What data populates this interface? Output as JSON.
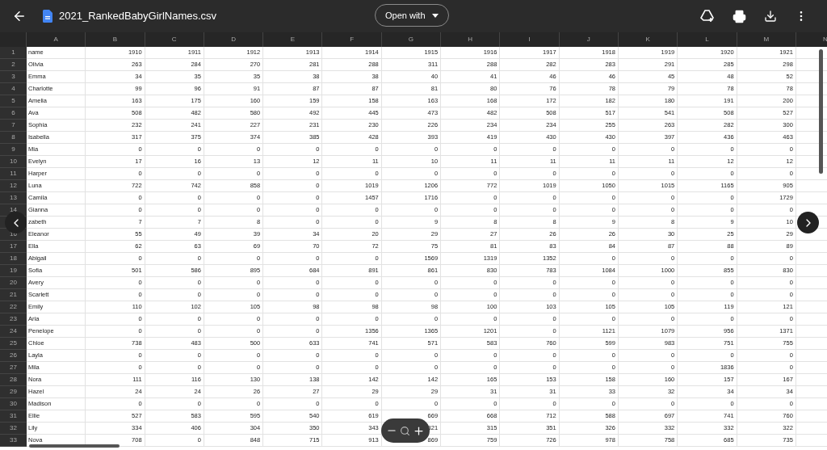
{
  "file": {
    "title": "2021_RankedBabyGirlNames.csv"
  },
  "toolbar": {
    "open_with": "Open with"
  },
  "columns": [
    "A",
    "B",
    "C",
    "D",
    "E",
    "F",
    "G",
    "H",
    "I",
    "J",
    "K",
    "L",
    "M",
    "N"
  ],
  "rows": [
    {
      "number": "1",
      "name": "name",
      "values": [
        "1910",
        "1911",
        "1912",
        "1913",
        "1914",
        "1915",
        "1916",
        "1917",
        "1918",
        "1919",
        "1920",
        "1921"
      ]
    },
    {
      "number": "2",
      "name": "Olivia",
      "values": [
        "263",
        "284",
        "270",
        "281",
        "288",
        "311",
        "288",
        "282",
        "283",
        "291",
        "285",
        "298"
      ]
    },
    {
      "number": "3",
      "name": "Emma",
      "values": [
        "34",
        "35",
        "35",
        "38",
        "38",
        "40",
        "41",
        "46",
        "46",
        "45",
        "48",
        "52"
      ]
    },
    {
      "number": "4",
      "name": "Charlotte",
      "values": [
        "99",
        "96",
        "91",
        "87",
        "87",
        "81",
        "80",
        "76",
        "78",
        "79",
        "78",
        "78"
      ]
    },
    {
      "number": "5",
      "name": "Amelia",
      "values": [
        "163",
        "175",
        "160",
        "159",
        "158",
        "163",
        "168",
        "172",
        "182",
        "180",
        "191",
        "200"
      ]
    },
    {
      "number": "6",
      "name": "Ava",
      "values": [
        "508",
        "482",
        "580",
        "492",
        "445",
        "473",
        "482",
        "508",
        "517",
        "541",
        "508",
        "527"
      ]
    },
    {
      "number": "7",
      "name": "Sophia",
      "values": [
        "232",
        "241",
        "227",
        "231",
        "230",
        "226",
        "234",
        "234",
        "255",
        "263",
        "282",
        "300"
      ]
    },
    {
      "number": "8",
      "name": "Isabella",
      "values": [
        "317",
        "375",
        "374",
        "385",
        "428",
        "393",
        "419",
        "430",
        "430",
        "397",
        "436",
        "463"
      ]
    },
    {
      "number": "9",
      "name": "Mia",
      "values": [
        "0",
        "0",
        "0",
        "0",
        "0",
        "0",
        "0",
        "0",
        "0",
        "0",
        "0",
        "0"
      ]
    },
    {
      "number": "10",
      "name": "Evelyn",
      "values": [
        "17",
        "16",
        "13",
        "12",
        "11",
        "10",
        "11",
        "11",
        "11",
        "11",
        "12",
        "12"
      ]
    },
    {
      "number": "11",
      "name": "Harper",
      "values": [
        "0",
        "0",
        "0",
        "0",
        "0",
        "0",
        "0",
        "0",
        "0",
        "0",
        "0",
        "0"
      ]
    },
    {
      "number": "12",
      "name": "Luna",
      "values": [
        "722",
        "742",
        "858",
        "0",
        "1019",
        "1206",
        "772",
        "1019",
        "1050",
        "1015",
        "1165",
        "905"
      ]
    },
    {
      "number": "13",
      "name": "Camila",
      "values": [
        "0",
        "0",
        "0",
        "0",
        "1457",
        "1716",
        "0",
        "0",
        "0",
        "0",
        "0",
        "1729"
      ]
    },
    {
      "number": "14",
      "name": "Gianna",
      "values": [
        "0",
        "0",
        "0",
        "0",
        "0",
        "0",
        "0",
        "0",
        "0",
        "0",
        "0",
        "0"
      ]
    },
    {
      "name": "zabeth",
      "values": [
        "7",
        "7",
        "8",
        "0",
        "0",
        "9",
        "8",
        "8",
        "9",
        "8",
        "9",
        "10"
      ]
    },
    {
      "number": "16",
      "name": "Eleanor",
      "values": [
        "55",
        "49",
        "39",
        "34",
        "20",
        "29",
        "27",
        "26",
        "26",
        "30",
        "25",
        "29"
      ]
    },
    {
      "number": "17",
      "name": "Ella",
      "values": [
        "62",
        "63",
        "69",
        "70",
        "72",
        "75",
        "81",
        "83",
        "84",
        "87",
        "88",
        "89"
      ]
    },
    {
      "number": "18",
      "name": "Abigail",
      "values": [
        "0",
        "0",
        "0",
        "0",
        "0",
        "1569",
        "1319",
        "1352",
        "0",
        "0",
        "0",
        "0"
      ]
    },
    {
      "number": "19",
      "name": "Sofia",
      "values": [
        "501",
        "586",
        "895",
        "684",
        "891",
        "861",
        "830",
        "783",
        "1084",
        "1000",
        "855",
        "830"
      ]
    },
    {
      "number": "20",
      "name": "Avery",
      "values": [
        "0",
        "0",
        "0",
        "0",
        "0",
        "0",
        "0",
        "0",
        "0",
        "0",
        "0",
        "0"
      ]
    },
    {
      "number": "21",
      "name": "Scarlett",
      "values": [
        "0",
        "0",
        "0",
        "0",
        "0",
        "0",
        "0",
        "0",
        "0",
        "0",
        "0",
        "0"
      ]
    },
    {
      "number": "22",
      "name": "Emily",
      "values": [
        "110",
        "102",
        "105",
        "98",
        "98",
        "98",
        "100",
        "103",
        "105",
        "105",
        "119",
        "121"
      ]
    },
    {
      "number": "23",
      "name": "Aria",
      "values": [
        "0",
        "0",
        "0",
        "0",
        "0",
        "0",
        "0",
        "0",
        "0",
        "0",
        "0",
        "0"
      ]
    },
    {
      "number": "24",
      "name": "Penelope",
      "values": [
        "0",
        "0",
        "0",
        "0",
        "1356",
        "1365",
        "1201",
        "0",
        "1121",
        "1079",
        "956",
        "1371"
      ]
    },
    {
      "number": "25",
      "name": "Chloe",
      "values": [
        "738",
        "483",
        "500",
        "633",
        "741",
        "571",
        "583",
        "760",
        "599",
        "983",
        "751",
        "755"
      ]
    },
    {
      "number": "26",
      "name": "Layla",
      "values": [
        "0",
        "0",
        "0",
        "0",
        "0",
        "0",
        "0",
        "0",
        "0",
        "0",
        "0",
        "0"
      ]
    },
    {
      "number": "27",
      "name": "Mila",
      "values": [
        "0",
        "0",
        "0",
        "0",
        "0",
        "0",
        "0",
        "0",
        "0",
        "0",
        "1836",
        "0"
      ]
    },
    {
      "number": "28",
      "name": "Nora",
      "values": [
        "111",
        "116",
        "130",
        "138",
        "142",
        "142",
        "165",
        "153",
        "158",
        "160",
        "157",
        "167"
      ]
    },
    {
      "number": "29",
      "name": "Hazel",
      "values": [
        "24",
        "24",
        "26",
        "27",
        "29",
        "29",
        "31",
        "31",
        "33",
        "32",
        "34",
        "34"
      ]
    },
    {
      "number": "30",
      "name": "Madison",
      "values": [
        "0",
        "0",
        "0",
        "0",
        "0",
        "0",
        "0",
        "0",
        "0",
        "0",
        "0",
        "0"
      ]
    },
    {
      "number": "31",
      "name": "Ellie",
      "values": [
        "527",
        "583",
        "595",
        "540",
        "619",
        "669",
        "668",
        "712",
        "588",
        "697",
        "741",
        "760"
      ]
    },
    {
      "number": "32",
      "name": "Lily",
      "values": [
        "334",
        "406",
        "304",
        "350",
        "343",
        "321",
        "315",
        "351",
        "326",
        "332",
        "332",
        "322"
      ]
    },
    {
      "number": "33",
      "name": "Nova",
      "values": [
        "708",
        "0",
        "848",
        "715",
        "913",
        "869",
        "759",
        "726",
        "978",
        "758",
        "685",
        "735"
      ]
    }
  ]
}
